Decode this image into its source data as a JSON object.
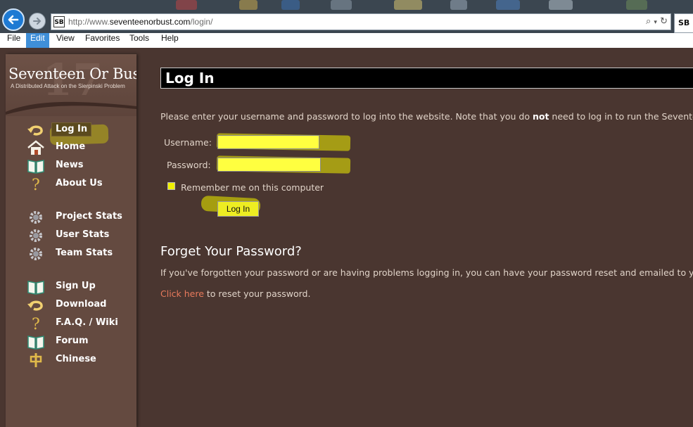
{
  "browser": {
    "url_prefix": "http://www.",
    "url_domain": "seventeenorbust.com",
    "url_path": "/login/",
    "site_badge": "SB",
    "tab_label": "SB",
    "menu": [
      "File",
      "Edit",
      "View",
      "Favorites",
      "Tools",
      "Help"
    ],
    "active_menu": "Edit"
  },
  "logo": {
    "title": "Seventeen Or Bust",
    "subtitle": "A Distributed Attack on the Sierpinski Problem",
    "big_number": "17"
  },
  "sidebar": {
    "items": [
      {
        "label": "Log In",
        "icon": "undo-arrow-icon"
      },
      {
        "label": "Home",
        "icon": "house-icon"
      },
      {
        "label": "News",
        "icon": "open-book-icon"
      },
      {
        "label": "About Us",
        "icon": "question-mark-icon"
      },
      {
        "label": "Project Stats",
        "icon": "gear-icon"
      },
      {
        "label": "User Stats",
        "icon": "gear-icon"
      },
      {
        "label": "Team Stats",
        "icon": "gear-icon"
      },
      {
        "label": "Sign Up",
        "icon": "open-book-icon"
      },
      {
        "label": "Download",
        "icon": "undo-arrow-icon"
      },
      {
        "label": "F.A.Q. / Wiki",
        "icon": "question-mark-icon"
      },
      {
        "label": "Forum",
        "icon": "open-book-icon"
      },
      {
        "label": "Chinese",
        "icon": "chinese-character-icon"
      }
    ]
  },
  "main": {
    "title": "Log In",
    "intro_before": "Please enter your username and password to log into the website. Note that you do ",
    "intro_bold": "not",
    "intro_after": " need to log in to run the Seventeen",
    "username_label": "Username:",
    "username_value": "",
    "password_label": "Password:",
    "password_value": "",
    "remember_label": "Remember me on this computer",
    "login_button": "Log In",
    "forgot_heading": "Forget Your Password?",
    "forgot_text": "If you've forgotten your password or are having problems logging in, you can have your password reset and emailed to you a",
    "reset_link": "Click here",
    "reset_after": " to reset your password."
  },
  "colors": {
    "page_bg": "#4a3630",
    "sidebar_bg": "#644a40",
    "highlight": "#f0f000",
    "link": "#e87a5c"
  }
}
